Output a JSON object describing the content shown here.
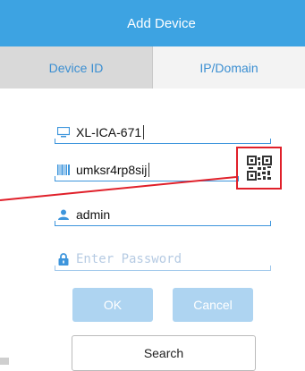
{
  "header": {
    "title": "Add Device"
  },
  "tabs": [
    {
      "label": "Device ID",
      "active": true
    },
    {
      "label": "IP/Domain",
      "active": false
    }
  ],
  "form": {
    "device_id": {
      "value": "XL-ICA-671",
      "icon": "monitor-icon"
    },
    "serial": {
      "value": "umksr4rp8sij",
      "icon": "barcode-icon"
    },
    "username": {
      "value": "admin",
      "icon": "user-icon"
    },
    "password": {
      "value": "",
      "placeholder": "Enter Password",
      "icon": "lock-icon"
    }
  },
  "qr_icon": "qr-code-icon",
  "buttons": {
    "ok": "OK",
    "cancel": "Cancel",
    "search": "Search"
  },
  "colors": {
    "accent": "#3da3e2",
    "highlight": "#e0202a",
    "button": "#aed4f1"
  }
}
